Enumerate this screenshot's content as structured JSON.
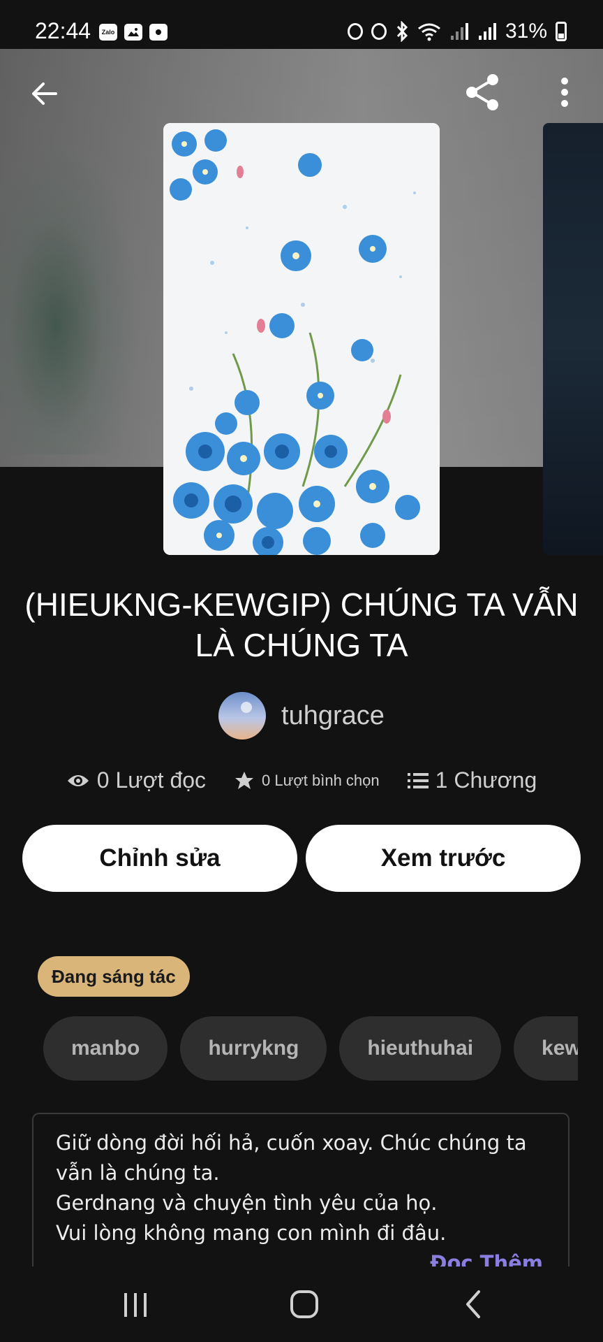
{
  "status_bar": {
    "time": "22:44",
    "left_icons": [
      "zalo-icon",
      "gallery-icon",
      "app-icon"
    ],
    "zalo_label": "Zalo",
    "battery": "31%"
  },
  "header": {
    "back": "back-arrow-icon",
    "share": "share-icon",
    "more": "more-vertical-icon"
  },
  "book": {
    "title": "(HIEUKNG-KEWGIP) CHÚNG TA VẪN LÀ CHÚNG TA",
    "author": "tuhgrace",
    "stats": {
      "reads": "0 Lượt đọc",
      "votes": "0 Lượt bình chọn",
      "chapters": "1 Chương"
    },
    "status_badge": "Đang sáng tác",
    "tags": [
      "manbo",
      "hurrykng",
      "hieuthuhai",
      "kewgip"
    ],
    "description": [
      "Giữ dòng đời hối hả, cuốn xoay. Chúc chúng ta vẫn là chúng ta.",
      "Gerdnang và chuyện tình yêu của họ.",
      "Vui lòng không mang con mình đi đâu."
    ],
    "read_more": "Đọc Thêm"
  },
  "actions": {
    "edit": "Chỉnh sửa",
    "preview": "Xem trước"
  },
  "colors": {
    "background": "#121212",
    "badge": "#d9b57a",
    "read_more": "#8a7fe0"
  }
}
